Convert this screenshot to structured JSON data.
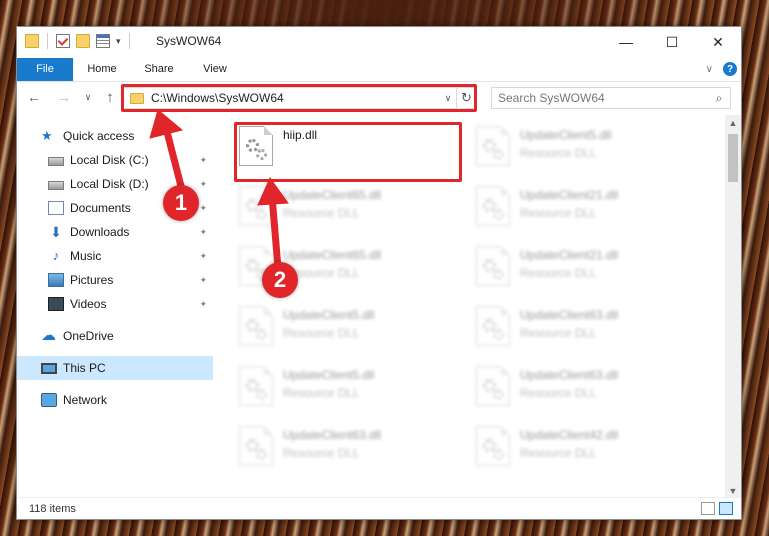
{
  "window": {
    "title": "SysWOW64",
    "controls": {
      "minimize": "—",
      "maximize": "☐",
      "close": "✕"
    }
  },
  "ribbon": {
    "tabs": [
      "File",
      "Home",
      "Share",
      "View"
    ],
    "help": "?",
    "expand": "∨"
  },
  "nav": {
    "back": "←",
    "forward": "→",
    "recent": "∨",
    "up": "↑"
  },
  "address": {
    "path": "C:\\Windows\\SysWOW64",
    "dropdown": "∨",
    "refresh": "↻"
  },
  "search": {
    "placeholder": "Search SysWOW64",
    "icon": "⌕"
  },
  "sidebar": {
    "items": [
      {
        "label": "Quick access",
        "icon": "star-icon",
        "pinned": false
      },
      {
        "label": "Local Disk (C:)",
        "icon": "disk-icon",
        "pinned": true
      },
      {
        "label": "Local Disk (D:)",
        "icon": "disk-icon",
        "pinned": true
      },
      {
        "label": "Documents",
        "icon": "documents-icon",
        "pinned": true
      },
      {
        "label": "Downloads",
        "icon": "download-icon",
        "pinned": true
      },
      {
        "label": "Music",
        "icon": "music-icon",
        "pinned": true
      },
      {
        "label": "Pictures",
        "icon": "pictures-icon",
        "pinned": true
      },
      {
        "label": "Videos",
        "icon": "videos-icon",
        "pinned": true
      },
      {
        "label": "OneDrive",
        "icon": "cloud-icon",
        "pinned": false
      },
      {
        "label": "This PC",
        "icon": "computer-icon",
        "pinned": false,
        "selected": true
      },
      {
        "label": "Network",
        "icon": "network-icon",
        "pinned": false
      }
    ],
    "pin_glyph": "📌"
  },
  "files": [
    {
      "name": "hiip.dll",
      "type": "",
      "blurred": false
    },
    {
      "name": "UpdateClient5.dll",
      "type": "Resource DLL",
      "blurred": true
    },
    {
      "name": "UpdateClient65.dll",
      "type": "Resource DLL",
      "blurred": true
    },
    {
      "name": "UpdateClient21.dll",
      "type": "Resource DLL",
      "blurred": true
    },
    {
      "name": "UpdateClient65.dll",
      "type": "Resource DLL",
      "blurred": true
    },
    {
      "name": "UpdateClient21.dll",
      "type": "Resource DLL",
      "blurred": true
    },
    {
      "name": "UpdateClient5.dll",
      "type": "Resource DLL",
      "blurred": true
    },
    {
      "name": "UpdateClient63.dll",
      "type": "Resource DLL",
      "blurred": true
    },
    {
      "name": "UpdateClient5.dll",
      "type": "Resource DLL",
      "blurred": true
    },
    {
      "name": "UpdateClient63.dll",
      "type": "Resource DLL",
      "blurred": true
    },
    {
      "name": "UpdateClient63.dll",
      "type": "Resource DLL",
      "blurred": true
    },
    {
      "name": "UpdateClient42.dll",
      "type": "Resource DLL",
      "blurred": true
    }
  ],
  "status": {
    "item_count": "118 items"
  },
  "annotations": {
    "badges": [
      "1",
      "2"
    ],
    "color": "#e0262a"
  },
  "colors": {
    "accent": "#1979ca",
    "selected_bg": "#cce8ff"
  }
}
